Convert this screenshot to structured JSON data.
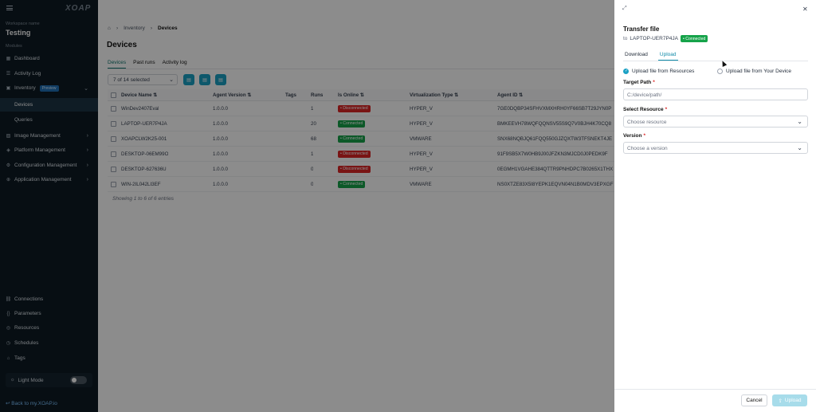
{
  "sidebar": {
    "logo": "XOAP",
    "workspace_label": "Workspace name",
    "workspace_name": "Testing",
    "modules_label": "Modules",
    "items": [
      {
        "label": "Dashboard",
        "icon": "grid-icon"
      },
      {
        "label": "Activity Log",
        "icon": "list-icon"
      },
      {
        "label": "Inventory",
        "icon": "box-icon",
        "badge": "Preview"
      },
      {
        "label": "Devices"
      },
      {
        "label": "Queries"
      },
      {
        "label": "Image Management",
        "icon": "image-icon"
      },
      {
        "label": "Platform Management",
        "icon": "layers-icon"
      },
      {
        "label": "Configuration Management",
        "icon": "gear-icon"
      },
      {
        "label": "Application Management",
        "icon": "app-icon"
      }
    ],
    "bottom_items": [
      {
        "label": "Connections",
        "icon": "link-icon"
      },
      {
        "label": "Parameters",
        "icon": "braces-icon"
      },
      {
        "label": "Resources",
        "icon": "globe-icon"
      },
      {
        "label": "Schedules",
        "icon": "clock-icon"
      },
      {
        "label": "Tags",
        "icon": "tag-icon"
      }
    ],
    "light_mode_label": "Light Mode",
    "back_link": "Back to my.XOAP.io"
  },
  "main": {
    "breadcrumb": [
      "Inventory",
      "Devices"
    ],
    "title": "Devices",
    "tabs": [
      "Devices",
      "Past runs",
      "Activity log"
    ],
    "selection": "7 of 14 selected",
    "columns": [
      "Device Name",
      "Agent Version",
      "Tags",
      "Runs",
      "Is Online",
      "Virtualization Type",
      "Agent ID"
    ],
    "rows": [
      {
        "name": "WinDev2407Eval",
        "version": "1.0.0.0",
        "runs": "1",
        "status": "Disconnected",
        "virt": "HYPER_V",
        "agent": "7GE0DQBP34SFHVXMXHRH0YF66SB7T29JYN0P"
      },
      {
        "name": "LAPTOP-UER7P4JA",
        "version": "1.0.0.0",
        "runs": "20",
        "status": "Connected",
        "virt": "HYPER_V",
        "agent": "BMKEEVH78WQFQQNSV55S9Q7V0BJH4K70CQ8"
      },
      {
        "name": "XOAPCLW2K25-001",
        "version": "1.0.0.0",
        "runs": "68",
        "status": "Connected",
        "virt": "VMWARE",
        "agent": "SNX68NQBJQ61FQQ550GJZQXTW3TFSNEKT4JE"
      },
      {
        "name": "DESKTOP-06EM99O",
        "version": "1.0.0.0",
        "runs": "1",
        "status": "Disconnected",
        "virt": "HYPER_V",
        "agent": "91F9SB5X7W0HB9J00JFZKN3MJCD0J0PEDK9F"
      },
      {
        "name": "DESKTOP-627636U",
        "version": "1.0.0.0",
        "runs": "0",
        "status": "Disconnected",
        "virt": "HYPER_V",
        "agent": "0EGMH1VGAHE384QTTR9PNHDPC7B0265X1THX"
      },
      {
        "name": "WIN-2IL042LI3EF",
        "version": "1.0.0.0",
        "runs": "0",
        "status": "Connected",
        "virt": "VMWARE",
        "agent": "NS0XTZE83X5I8YEPK1EQVN04N1B0MDV3EPXGF"
      }
    ],
    "showing": "Showing 1 to 6 of 6 entries"
  },
  "panel": {
    "title": "Transfer file",
    "to_label": "to",
    "device": "LAPTOP-UER7P4JA",
    "status": "Connected",
    "tabs": [
      "Download",
      "Upload"
    ],
    "radio_resources": "Upload file from Resources",
    "radio_device": "Upload file from Your Device",
    "target_label": "Target Path",
    "target_value": "C:/device/path/",
    "resource_label": "Select Resource",
    "resource_placeholder": "Choose resource",
    "version_label": "Version",
    "version_placeholder": "Choose a version",
    "cancel": "Cancel",
    "upload": "Upload"
  },
  "colors": {
    "accent": "#1ba1c4",
    "sidebar": "#0d1a24",
    "connected": "#16a34a",
    "disconnected": "#dc2626"
  }
}
